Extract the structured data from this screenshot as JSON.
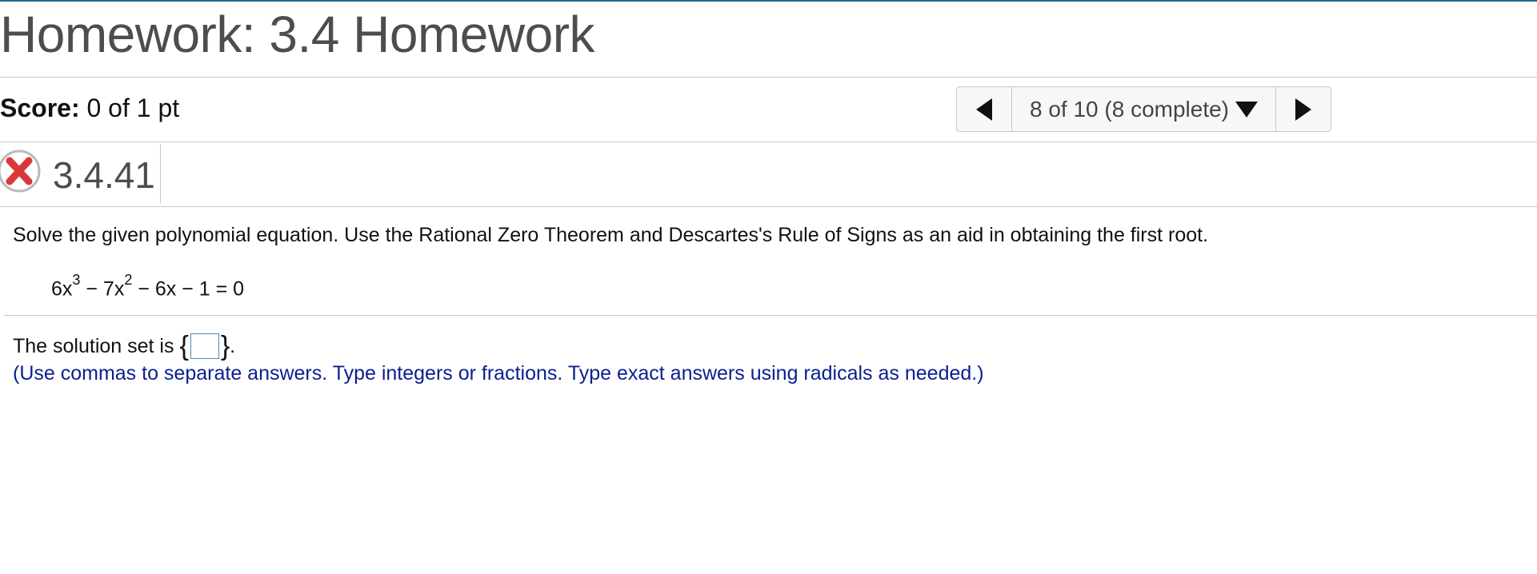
{
  "header": {
    "title": "Homework: 3.4 Homework"
  },
  "score": {
    "label": "Score:",
    "value": "0 of 1 pt"
  },
  "navigator": {
    "progress": "8 of 10 (8 complete)",
    "prev_icon": "triangle-left-icon",
    "next_icon": "triangle-right-icon",
    "dropdown_icon": "caret-down-icon"
  },
  "question": {
    "number": "3.4.41",
    "status_icon": "incorrect-x-icon",
    "status_color": "#d9383a",
    "prompt": "Solve the given polynomial equation. Use the Rational Zero Theorem and Descartes's Rule of Signs as an aid in obtaining the first root.",
    "equation": {
      "term1_base": "6x",
      "term1_exp": "3",
      "term2_base": " − 7x",
      "term2_exp": "2",
      "rest": " − 6x − 1 = 0"
    },
    "answer_prefix": "The solution set is",
    "brace_open": "{",
    "brace_close": "}",
    "answer_suffix": ".",
    "answer_value": "",
    "hint": "(Use commas to separate answers. Type integers or fractions. Type exact answers using radicals as needed.)"
  },
  "colors": {
    "accent_rule": "#1f6f8b",
    "hint_text": "#0a1f8f",
    "answer_box_border": "#4a8fb0"
  }
}
